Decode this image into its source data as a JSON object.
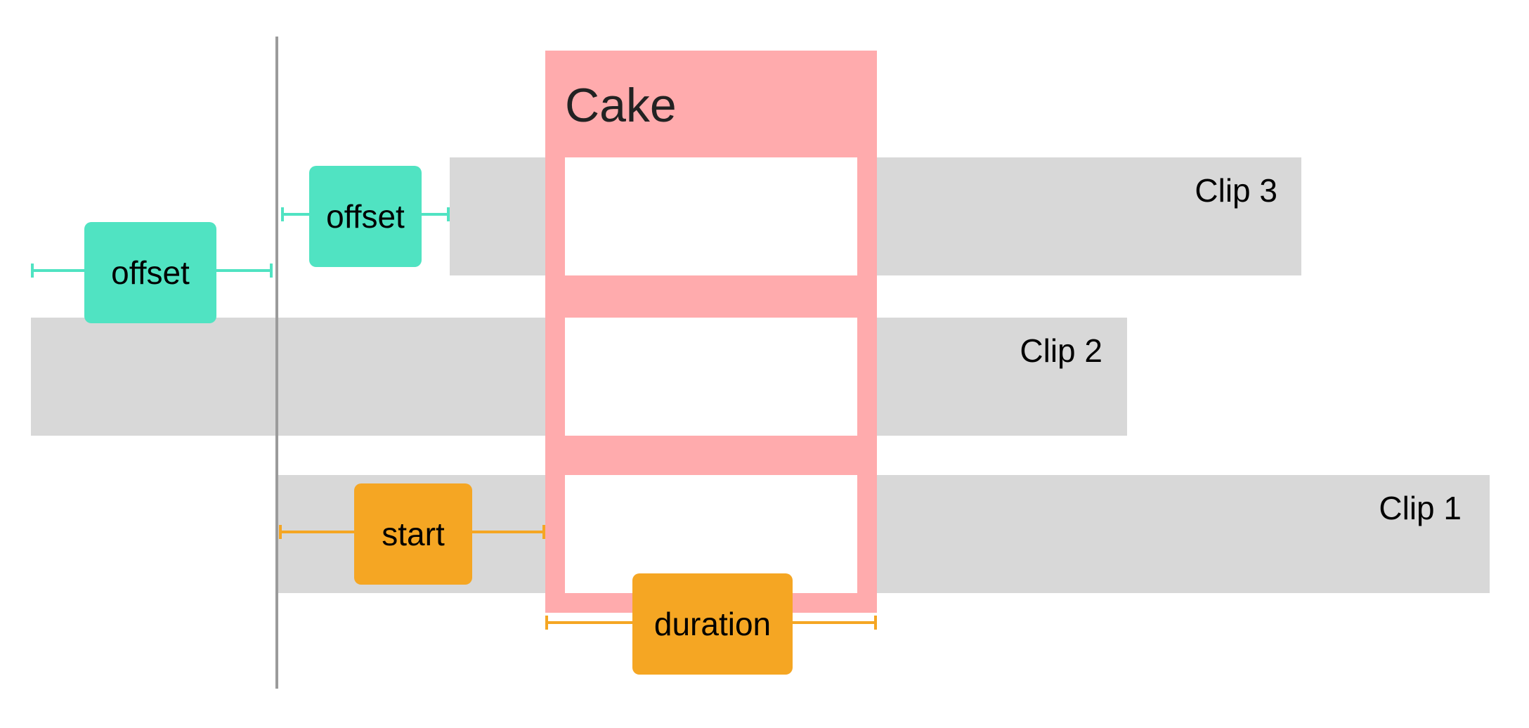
{
  "diagram": {
    "composition": {
      "title": "Cake",
      "color": "#ffabad"
    },
    "playhead": {
      "color": "#9b9b9b"
    },
    "clips": [
      {
        "id": "clip-1",
        "label": "Clip 1",
        "color": "#d8d8d8"
      },
      {
        "id": "clip-2",
        "label": "Clip 2",
        "color": "#d8d8d8"
      },
      {
        "id": "clip-3",
        "label": "Clip 3",
        "color": "#d8d8d8"
      }
    ],
    "measures": {
      "offset_track_2": {
        "label": "offset",
        "color": "#50e3c2"
      },
      "offset_track_3": {
        "label": "offset",
        "color": "#50e3c2"
      },
      "start": {
        "label": "start",
        "color": "#f5a623"
      },
      "duration": {
        "label": "duration",
        "color": "#f5a623"
      }
    }
  }
}
